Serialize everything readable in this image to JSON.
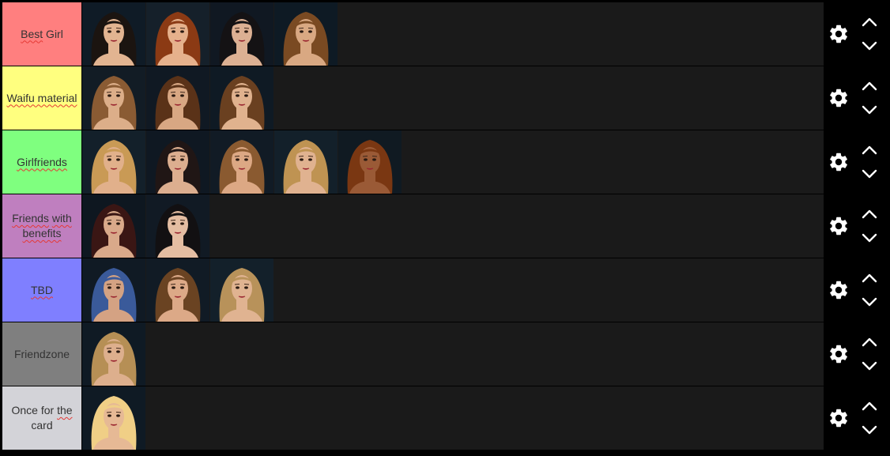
{
  "tiers": [
    {
      "label_parts": [
        {
          "text": "Best",
          "squiggle": true
        },
        {
          "text": " Girl",
          "squiggle": false
        }
      ],
      "color": "#FF7F7F",
      "items": [
        {
          "name": "portrait-dark-hair",
          "hair": "#1b1410",
          "skin": "#e2b491",
          "bg": "#0f1b26"
        },
        {
          "name": "portrait-auburn-curly",
          "hair": "#8b3a14",
          "skin": "#e6b18c",
          "bg": "#15202a"
        },
        {
          "name": "portrait-black-wavy",
          "hair": "#141214",
          "skin": "#dcb093",
          "bg": "#101822"
        },
        {
          "name": "portrait-brown-ponytail",
          "hair": "#7a4a22",
          "skin": "#d9a882",
          "bg": "#0e1a24"
        }
      ]
    },
    {
      "label_parts": [
        {
          "text": "Waifu material",
          "squiggle": true
        }
      ],
      "color": "#FFFF7F",
      "items": [
        {
          "name": "portrait-light-brown-long",
          "hair": "#8a5b33",
          "skin": "#dcae89",
          "bg": "#121c25"
        },
        {
          "name": "portrait-brown-shoulder",
          "hair": "#5a3218",
          "skin": "#d8a783",
          "bg": "#101923"
        },
        {
          "name": "portrait-brown-bun",
          "hair": "#6a4020",
          "skin": "#e0b28e",
          "bg": "#0f1a24"
        }
      ]
    },
    {
      "label_parts": [
        {
          "text": "Girlfriends",
          "squiggle": true
        }
      ],
      "color": "#7FFF7F",
      "items": [
        {
          "name": "portrait-blonde-wavy",
          "hair": "#c99a55",
          "skin": "#e1b08b",
          "bg": "#13202a"
        },
        {
          "name": "portrait-dark-space-buns",
          "hair": "#201615",
          "skin": "#dcae8f",
          "bg": "#0f1822"
        },
        {
          "name": "portrait-light-brown-wavy",
          "hair": "#8a5a30",
          "skin": "#dca884",
          "bg": "#111b25"
        },
        {
          "name": "portrait-blonde-curly",
          "hair": "#bf9352",
          "skin": "#e0b290",
          "bg": "#13202a"
        },
        {
          "name": "portrait-red-curly",
          "hair": "#7a3712",
          "skin": "#9a5a36",
          "bg": "#101a22"
        }
      ]
    },
    {
      "label_parts": [
        {
          "text": "Friends",
          "squiggle": true
        },
        {
          "text": " ",
          "squiggle": false
        },
        {
          "text": "with",
          "squiggle": true
        },
        {
          "text": " ",
          "squiggle": false
        },
        {
          "text": "benefits",
          "squiggle": true
        }
      ],
      "color": "#BF7FBF",
      "items": [
        {
          "name": "portrait-dark-red-curly",
          "hair": "#3a1614",
          "skin": "#d9a98a",
          "bg": "#0e1720"
        },
        {
          "name": "portrait-black-bob",
          "hair": "#121012",
          "skin": "#e4bda2",
          "bg": "#111a24"
        }
      ]
    },
    {
      "label_parts": [
        {
          "text": "TBD",
          "squiggle": true
        }
      ],
      "color": "#7F7FFF",
      "items": [
        {
          "name": "portrait-blue-hair",
          "hair": "#3a5a9a",
          "skin": "#d4a283",
          "bg": "#101a24"
        },
        {
          "name": "portrait-brown-long-straight",
          "hair": "#6a4322",
          "skin": "#dca987",
          "bg": "#111b25"
        },
        {
          "name": "portrait-blonde-braids",
          "hair": "#b8925a",
          "skin": "#e0b391",
          "bg": "#13202a"
        }
      ]
    },
    {
      "label_parts": [
        {
          "text": "Friendzone",
          "squiggle": false
        }
      ],
      "color": "#7F7F7F",
      "items": [
        {
          "name": "portrait-blonde-shoulder",
          "hair": "#b68f55",
          "skin": "#ddaf8d",
          "bg": "#0f1a24"
        }
      ]
    },
    {
      "label_parts": [
        {
          "text": "Once for ",
          "squiggle": false
        },
        {
          "text": "the",
          "squiggle": true
        },
        {
          "text": " card",
          "squiggle": false
        }
      ],
      "color": "#D3D3D8",
      "items": [
        {
          "name": "portrait-platinum-blonde",
          "hair": "#f0cf86",
          "skin": "#e6b995",
          "bg": "#0f1a24"
        }
      ]
    }
  ],
  "icons": {
    "settings": "gear-icon",
    "up": "chevron-up-icon",
    "down": "chevron-down-icon"
  }
}
